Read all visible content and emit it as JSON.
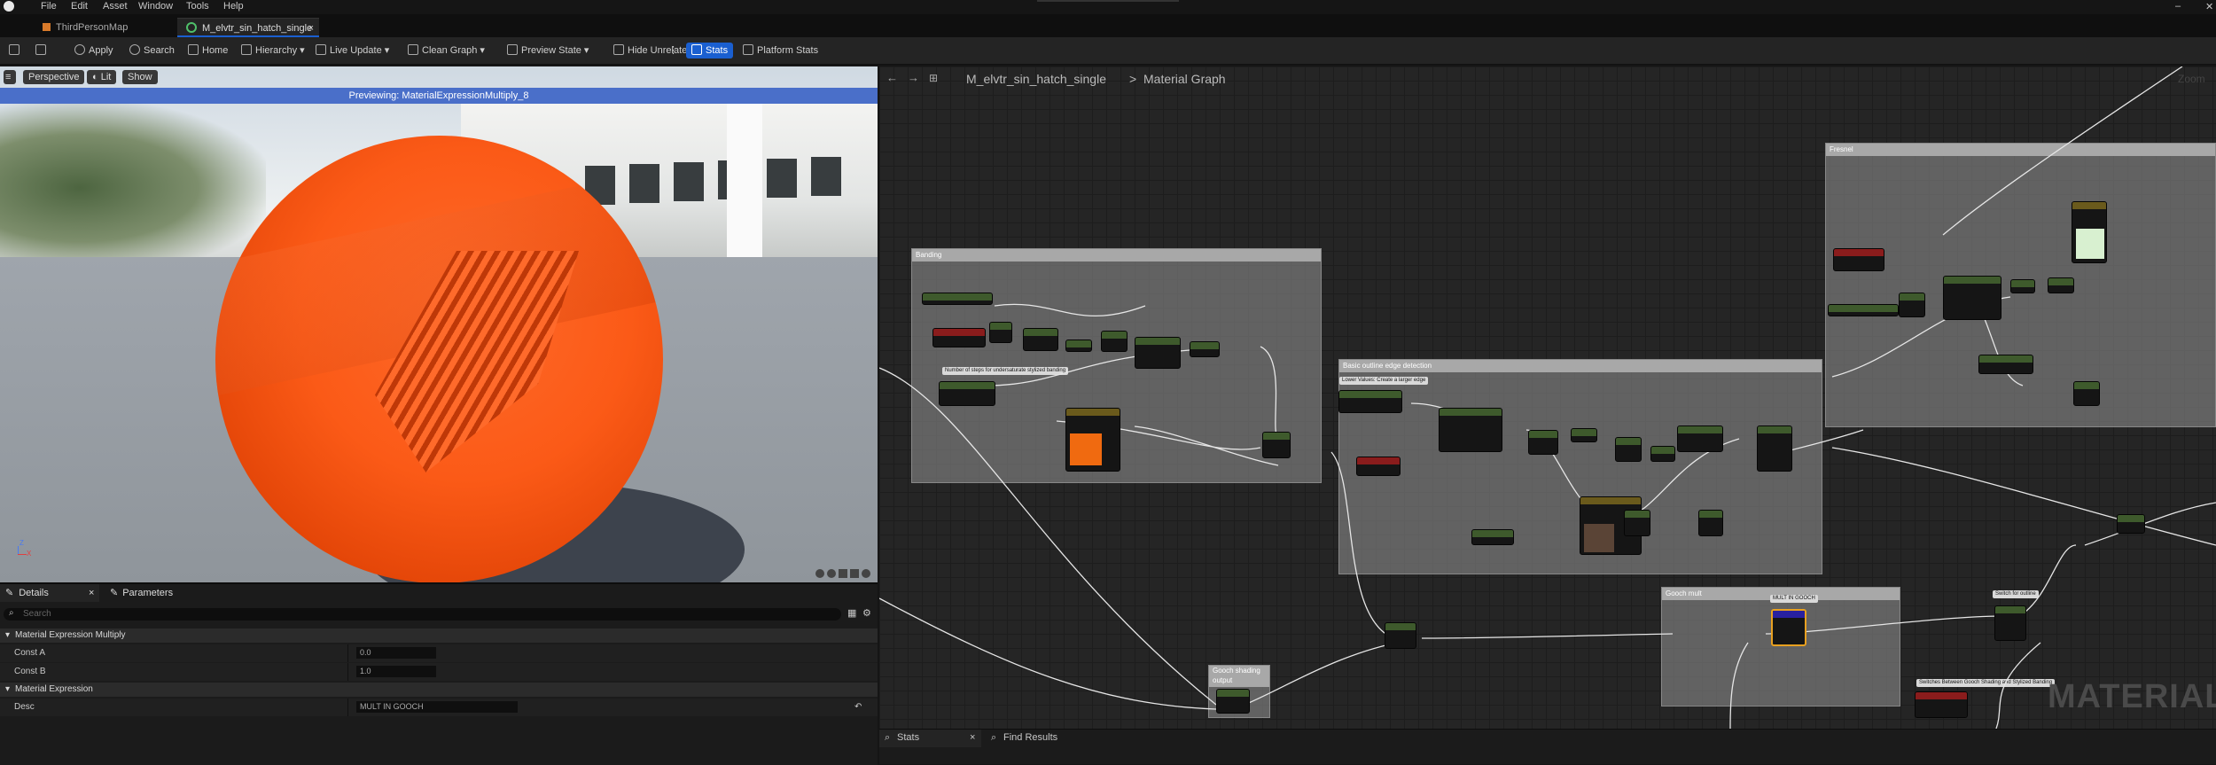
{
  "menu": {
    "items": [
      "File",
      "Edit",
      "Asset",
      "Window",
      "Tools",
      "Help"
    ]
  },
  "tabs": [
    {
      "label": "ThirdPersonMap"
    },
    {
      "label": "M_elvtr_sin_hatch_single",
      "close": "×"
    }
  ],
  "toolbar": {
    "apply": "Apply",
    "search": "Search",
    "home": "Home",
    "hierarchy": "Hierarchy",
    "live_update": "Live Update",
    "clean_graph": "Clean Graph",
    "preview_state": "Preview State",
    "hide_unrelated": "Hide Unrelated",
    "stats": "Stats",
    "platform_stats": "Platform Stats"
  },
  "viewport": {
    "perspective": "Perspective",
    "lit": "Lit",
    "show": "Show",
    "preview_banner": "Previewing: MaterialExpressionMultiply_8",
    "axis_z": "Z",
    "axis_x": "X"
  },
  "details": {
    "tab_details": "Details",
    "tab_parameters": "Parameters",
    "search_placeholder": "Search",
    "cat_multiply": "Material Expression Multiply",
    "const_a_label": "Const A",
    "const_a_value": "0.0",
    "const_b_label": "Const B",
    "const_b_value": "1.0",
    "cat_expression": "Material Expression",
    "desc_label": "Desc",
    "desc_value": "MULT IN GOOCH"
  },
  "graph": {
    "breadcrumb_asset": "M_elvtr_sin_hatch_single",
    "breadcrumb_sep": ">",
    "breadcrumb_graph": "Material Graph",
    "zoom": "Zoom",
    "watermark": "MATERIAL",
    "comments": {
      "banding": "Banding",
      "basic_outline": "Basic outline edge detection",
      "fresnel": "Fresnel",
      "gooch_mult": "Gooch mult",
      "gooch_shading": "Gooch shading output"
    },
    "notes": {
      "steps": "Number of steps for undersaturate stylized banding",
      "inner": "Lower Values: Create a larger edge",
      "gooch_mult_tag": "MULT IN GOOCH",
      "switch_tag": "Switch for outline",
      "toggle_tag": "Switches Between Gooch Shading and Stylized Banding"
    }
  },
  "bottom": {
    "stats": "Stats",
    "find_results": "Find Results"
  },
  "colors": {
    "accent": "#1a5fd0",
    "banner": "#4a6fc9",
    "sphere": "#fb5a17"
  }
}
